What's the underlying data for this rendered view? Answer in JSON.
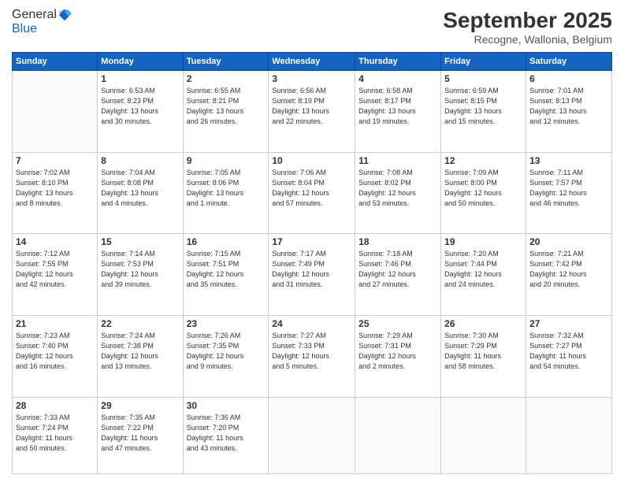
{
  "header": {
    "logo": {
      "line1": "General",
      "line2": "Blue"
    },
    "title": "September 2025",
    "location": "Recogne, Wallonia, Belgium"
  },
  "weekdays": [
    "Sunday",
    "Monday",
    "Tuesday",
    "Wednesday",
    "Thursday",
    "Friday",
    "Saturday"
  ],
  "weeks": [
    [
      {
        "day": "",
        "detail": ""
      },
      {
        "day": "1",
        "detail": "Sunrise: 6:53 AM\nSunset: 8:23 PM\nDaylight: 13 hours\nand 30 minutes."
      },
      {
        "day": "2",
        "detail": "Sunrise: 6:55 AM\nSunset: 8:21 PM\nDaylight: 13 hours\nand 26 minutes."
      },
      {
        "day": "3",
        "detail": "Sunrise: 6:56 AM\nSunset: 8:19 PM\nDaylight: 13 hours\nand 22 minutes."
      },
      {
        "day": "4",
        "detail": "Sunrise: 6:58 AM\nSunset: 8:17 PM\nDaylight: 13 hours\nand 19 minutes."
      },
      {
        "day": "5",
        "detail": "Sunrise: 6:59 AM\nSunset: 8:15 PM\nDaylight: 13 hours\nand 15 minutes."
      },
      {
        "day": "6",
        "detail": "Sunrise: 7:01 AM\nSunset: 8:13 PM\nDaylight: 13 hours\nand 12 minutes."
      }
    ],
    [
      {
        "day": "7",
        "detail": "Sunrise: 7:02 AM\nSunset: 8:10 PM\nDaylight: 13 hours\nand 8 minutes."
      },
      {
        "day": "8",
        "detail": "Sunrise: 7:04 AM\nSunset: 8:08 PM\nDaylight: 13 hours\nand 4 minutes."
      },
      {
        "day": "9",
        "detail": "Sunrise: 7:05 AM\nSunset: 8:06 PM\nDaylight: 13 hours\nand 1 minute."
      },
      {
        "day": "10",
        "detail": "Sunrise: 7:06 AM\nSunset: 8:04 PM\nDaylight: 12 hours\nand 57 minutes."
      },
      {
        "day": "11",
        "detail": "Sunrise: 7:08 AM\nSunset: 8:02 PM\nDaylight: 12 hours\nand 53 minutes."
      },
      {
        "day": "12",
        "detail": "Sunrise: 7:09 AM\nSunset: 8:00 PM\nDaylight: 12 hours\nand 50 minutes."
      },
      {
        "day": "13",
        "detail": "Sunrise: 7:11 AM\nSunset: 7:57 PM\nDaylight: 12 hours\nand 46 minutes."
      }
    ],
    [
      {
        "day": "14",
        "detail": "Sunrise: 7:12 AM\nSunset: 7:55 PM\nDaylight: 12 hours\nand 42 minutes."
      },
      {
        "day": "15",
        "detail": "Sunrise: 7:14 AM\nSunset: 7:53 PM\nDaylight: 12 hours\nand 39 minutes."
      },
      {
        "day": "16",
        "detail": "Sunrise: 7:15 AM\nSunset: 7:51 PM\nDaylight: 12 hours\nand 35 minutes."
      },
      {
        "day": "17",
        "detail": "Sunrise: 7:17 AM\nSunset: 7:49 PM\nDaylight: 12 hours\nand 31 minutes."
      },
      {
        "day": "18",
        "detail": "Sunrise: 7:18 AM\nSunset: 7:46 PM\nDaylight: 12 hours\nand 27 minutes."
      },
      {
        "day": "19",
        "detail": "Sunrise: 7:20 AM\nSunset: 7:44 PM\nDaylight: 12 hours\nand 24 minutes."
      },
      {
        "day": "20",
        "detail": "Sunrise: 7:21 AM\nSunset: 7:42 PM\nDaylight: 12 hours\nand 20 minutes."
      }
    ],
    [
      {
        "day": "21",
        "detail": "Sunrise: 7:23 AM\nSunset: 7:40 PM\nDaylight: 12 hours\nand 16 minutes."
      },
      {
        "day": "22",
        "detail": "Sunrise: 7:24 AM\nSunset: 7:38 PM\nDaylight: 12 hours\nand 13 minutes."
      },
      {
        "day": "23",
        "detail": "Sunrise: 7:26 AM\nSunset: 7:35 PM\nDaylight: 12 hours\nand 9 minutes."
      },
      {
        "day": "24",
        "detail": "Sunrise: 7:27 AM\nSunset: 7:33 PM\nDaylight: 12 hours\nand 5 minutes."
      },
      {
        "day": "25",
        "detail": "Sunrise: 7:29 AM\nSunset: 7:31 PM\nDaylight: 12 hours\nand 2 minutes."
      },
      {
        "day": "26",
        "detail": "Sunrise: 7:30 AM\nSunset: 7:29 PM\nDaylight: 11 hours\nand 58 minutes."
      },
      {
        "day": "27",
        "detail": "Sunrise: 7:32 AM\nSunset: 7:27 PM\nDaylight: 11 hours\nand 54 minutes."
      }
    ],
    [
      {
        "day": "28",
        "detail": "Sunrise: 7:33 AM\nSunset: 7:24 PM\nDaylight: 11 hours\nand 50 minutes."
      },
      {
        "day": "29",
        "detail": "Sunrise: 7:35 AM\nSunset: 7:22 PM\nDaylight: 11 hours\nand 47 minutes."
      },
      {
        "day": "30",
        "detail": "Sunrise: 7:36 AM\nSunset: 7:20 PM\nDaylight: 11 hours\nand 43 minutes."
      },
      {
        "day": "",
        "detail": ""
      },
      {
        "day": "",
        "detail": ""
      },
      {
        "day": "",
        "detail": ""
      },
      {
        "day": "",
        "detail": ""
      }
    ]
  ]
}
